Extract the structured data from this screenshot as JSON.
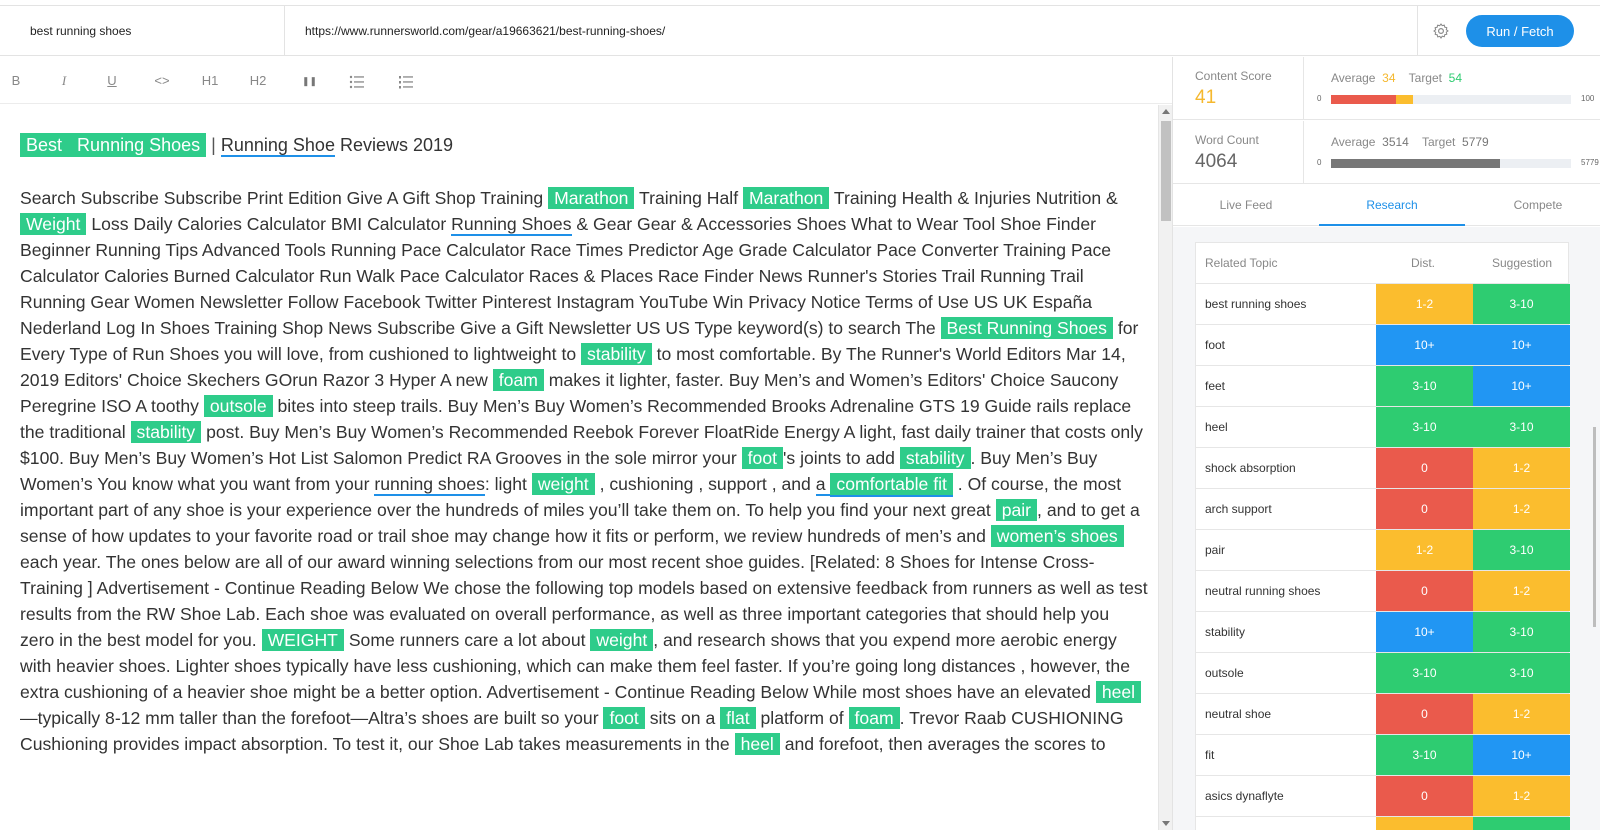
{
  "topbar": {
    "keyword": "best running shoes",
    "url": "https://www.runnersworld.com/gear/a19663621/best-running-shoes/",
    "run_label": "Run / Fetch"
  },
  "toolbar": {
    "bold": "B",
    "italic": "I",
    "underline": "U",
    "code": "<>",
    "h1": "H1",
    "h2": "H2",
    "quote": "❚❚"
  },
  "editor": {
    "title_hl1": "Best",
    "title_hl2": "Running Shoes",
    "title_sep": "|",
    "title_ul": "Running Shoe",
    "title_rest": " Reviews 2019",
    "segments": [
      {
        "t": "Search Subscribe Subscribe Print Edition Give A Gift Shop Training "
      },
      {
        "t": "Marathon",
        "s": "hl"
      },
      {
        "t": " Training Half "
      },
      {
        "t": "Marathon",
        "s": "hl"
      },
      {
        "t": " Training Health & Injuries Nutrition & "
      },
      {
        "t": "Weight",
        "s": "hl"
      },
      {
        "t": " Loss Daily Calories Calculator BMI Calculator "
      },
      {
        "t": "Running Shoes",
        "s": "ul"
      },
      {
        "t": " & Gear Gear & Accessories Shoes What to Wear Tool Shoe Finder Beginner Running Tips Advanced Tools Running Pace Calculator Race Times Predictor Age Grade Calculator Pace Converter Training Pace Calculator Calories Burned Calculator Run Walk Pace Calculator Races & Places Race Finder News Runner's Stories Trail Running Trail Running Gear Women Newsletter Follow Facebook Twitter Pinterest Instagram YouTube Win Privacy Notice Terms of Use US UK España Nederland Log In Shoes Training Shop News Subscribe Give a Gift Newsletter US US Type keyword(s) to search The "
      },
      {
        "t": "Best  Running Shoes",
        "s": "hl"
      },
      {
        "t": " for Every Type of Run Shoes you will love, from cushioned to lightweight to "
      },
      {
        "t": "stability",
        "s": "hl"
      },
      {
        "t": " to most comfortable. By The Runner's World Editors Mar 14, 2019 Editors' Choice Skechers GOrun Razor 3 Hyper A new "
      },
      {
        "t": "foam",
        "s": "hl"
      },
      {
        "t": " makes it lighter, faster. Buy Men’s and Women’s Editors' Choice Saucony Peregrine ISO A toothy "
      },
      {
        "t": "outsole",
        "s": "hl"
      },
      {
        "t": " bites into steep trails. Buy Men’s Buy Women’s Recommended Brooks Adrenaline GTS 19 Guide rails replace the traditional "
      },
      {
        "t": "stability",
        "s": "hl"
      },
      {
        "t": " post. Buy Men’s Buy Women’s Recommended Reebok Forever FloatRide Energy A light, fast daily trainer that costs only $100. Buy Men’s Buy Women’s Hot List Salomon Predict RA Grooves in the sole mirror your "
      },
      {
        "t": "foot",
        "s": "hl"
      },
      {
        "t": "'s joints to add "
      },
      {
        "t": "stability",
        "s": "hl"
      },
      {
        "t": ". Buy Men’s Buy Women’s You know what you want from your "
      },
      {
        "t": "running shoes",
        "s": "ul"
      },
      {
        "t": ": light "
      },
      {
        "t": "weight",
        "s": "hl"
      },
      {
        "t": " , cushioning , support , and "
      },
      {
        "t": "a ",
        "s": "ul"
      },
      {
        "t": "comfortable  fit",
        "s": "hlul"
      },
      {
        "t": " . Of course, the most important part of any shoe is your experience over the hundreds of miles you’ll take them on. To help you find your next great "
      },
      {
        "t": "pair",
        "s": "hl"
      },
      {
        "t": ", and to get a sense of how updates to your favorite road or trail shoe may change how it fits or perform, we review hundreds of men’s and "
      },
      {
        "t": "women’s shoes",
        "s": "hl"
      },
      {
        "t": " each year. The ones below are all of our award winning selections from our most recent shoe guides. [Related: 8 Shoes for Intense Cross-Training ] Advertisement - Continue Reading Below We chose the following top models based on extensive feedback from runners as well as test results from the RW Shoe Lab. Each shoe was evaluated on overall performance, as well as three important categories that should help you zero in the best model for you. "
      },
      {
        "t": "WEIGHT",
        "s": "hl"
      },
      {
        "t": " Some runners care a lot about "
      },
      {
        "t": "weight",
        "s": "hl"
      },
      {
        "t": ", and research shows that you expend more aerobic energy with heavier shoes. Lighter shoes typically have less cushioning, which can make them feel faster. If you’re going long distances , however, the extra cushioning of a heavier shoe might be a better option. Advertisement - Continue Reading Below While most shoes have an elevated "
      },
      {
        "t": "heel",
        "s": "hl"
      },
      {
        "t": "—typically 8-12 mm taller than the forefoot—Altra’s shoes are built so your "
      },
      {
        "t": "foot",
        "s": "hl"
      },
      {
        "t": " sits on a "
      },
      {
        "t": "flat",
        "s": "hl"
      },
      {
        "t": " platform of "
      },
      {
        "t": "foam",
        "s": "hl"
      },
      {
        "t": ". Trevor Raab CUSHIONING Cushioning provides impact absorption. To test it, our Shoe Lab takes measurements in the "
      },
      {
        "t": "heel",
        "s": "hl"
      },
      {
        "t": " and forefoot, then averages the scores to"
      }
    ]
  },
  "metrics": {
    "content_score": {
      "label": "Content Score",
      "value": "41",
      "avg_label": "Average",
      "avg": "34",
      "target_label": "Target",
      "target": "54",
      "min": "0",
      "max": "100",
      "fill": 0.27,
      "avg_fill": 0.34
    },
    "word_count": {
      "label": "Word Count",
      "value": "4064",
      "avg_label": "Average",
      "avg": "3514",
      "target_label": "Target",
      "target": "5779",
      "min": "0",
      "max": "5779",
      "fill": 0.703
    }
  },
  "tabs": [
    "Live Feed",
    "Research",
    "Compete"
  ],
  "active_tab": 1,
  "related": {
    "headers": {
      "topic": "Related Topic",
      "dist": "Dist.",
      "sugg": "Suggestion"
    },
    "colors": {
      "yellow": "#fbbd2e",
      "green": "#2ecc71",
      "blue": "#2196f3",
      "red": "#ea5a4c"
    },
    "rows": [
      {
        "topic": "best running shoes",
        "dist": "1-2",
        "dc": "yellow",
        "sugg": "3-10",
        "sc": "green"
      },
      {
        "topic": "foot",
        "dist": "10+",
        "dc": "blue",
        "sugg": "10+",
        "sc": "blue"
      },
      {
        "topic": "feet",
        "dist": "3-10",
        "dc": "green",
        "sugg": "10+",
        "sc": "blue"
      },
      {
        "topic": "heel",
        "dist": "3-10",
        "dc": "green",
        "sugg": "3-10",
        "sc": "green"
      },
      {
        "topic": "shock absorption",
        "dist": "0",
        "dc": "red",
        "sugg": "1-2",
        "sc": "yellow"
      },
      {
        "topic": "arch support",
        "dist": "0",
        "dc": "red",
        "sugg": "1-2",
        "sc": "yellow"
      },
      {
        "topic": "pair",
        "dist": "1-2",
        "dc": "yellow",
        "sugg": "3-10",
        "sc": "green"
      },
      {
        "topic": "neutral running shoes",
        "dist": "0",
        "dc": "red",
        "sugg": "1-2",
        "sc": "yellow"
      },
      {
        "topic": "stability",
        "dist": "10+",
        "dc": "blue",
        "sugg": "3-10",
        "sc": "green"
      },
      {
        "topic": "outsole",
        "dist": "3-10",
        "dc": "green",
        "sugg": "3-10",
        "sc": "green"
      },
      {
        "topic": "neutral shoe",
        "dist": "0",
        "dc": "red",
        "sugg": "1-2",
        "sc": "yellow"
      },
      {
        "topic": "fit",
        "dist": "3-10",
        "dc": "green",
        "sugg": "10+",
        "sc": "blue"
      },
      {
        "topic": "asics dynaflyte",
        "dist": "0",
        "dc": "red",
        "sugg": "1-2",
        "sc": "yellow"
      },
      {
        "topic": "",
        "dist": "",
        "dc": "yellow",
        "sugg": "",
        "sc": "green"
      }
    ]
  },
  "icons": {
    "gear": "gear-icon",
    "bullet_list": "bullet-list-icon",
    "numbered_list": "numbered-list-icon"
  }
}
